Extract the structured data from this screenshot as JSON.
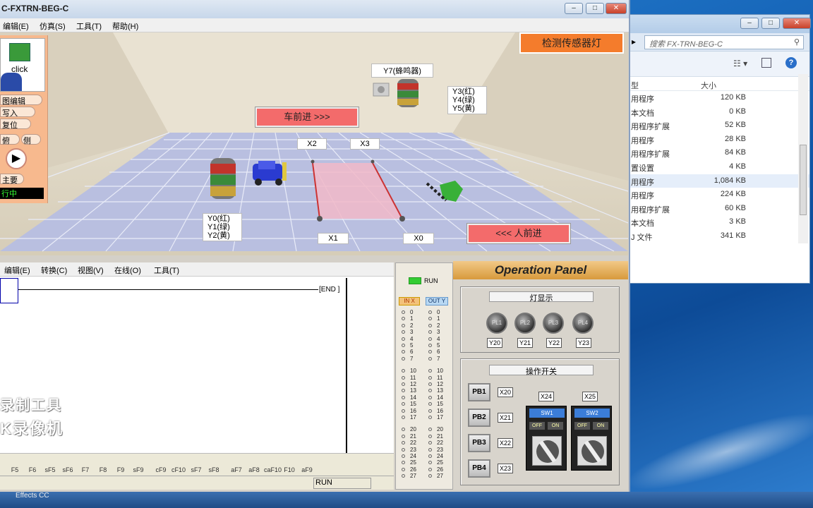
{
  "app": {
    "title": "C-FXTRN-BEG-C",
    "menu": [
      "编辑(E)",
      "仿真(S)",
      "工具(T)",
      "帮助(H)"
    ],
    "window_controls": [
      "minimize-icon",
      "maximize-icon",
      "close-icon"
    ]
  },
  "scene": {
    "sensor_button": "检测传感器灯",
    "car_forward": "车前进 >>>",
    "person_forward": "<<< 人前进",
    "buzzer_label": "Y7(蜂鸣器)",
    "tower_right_labels": [
      "Y3(红)",
      "Y4(绿)",
      "Y5(黄)"
    ],
    "tower_left_labels": [
      "Y0(红)",
      "Y1(绿)",
      "Y2(黄)"
    ],
    "sensors": {
      "x2": "X2",
      "x3": "X3",
      "x1": "X1",
      "x0": "X0"
    }
  },
  "left_strip": {
    "click": "click",
    "buttons": [
      "图编辑",
      "写入",
      "复位",
      "俯",
      "侧",
      "主要"
    ],
    "running": "行中"
  },
  "ladder": {
    "menu": [
      "编辑(E)",
      "转换(C)",
      "视图(V)",
      "在线(O)",
      "工具(T)"
    ],
    "end": "END",
    "watermark1": "录制工具",
    "watermark2": "K录像机",
    "fkeys": [
      "F5",
      "F6",
      "sF5",
      "sF6",
      "F7",
      "F8",
      "F9",
      "sF9",
      "cF9",
      "cF10",
      "sF7",
      "sF8",
      "aF7",
      "aF8",
      "caF10",
      "F10",
      "aF9"
    ],
    "status": "RUN"
  },
  "io": {
    "run": "RUN",
    "in_header": "IN X",
    "out_header": "OUT Y",
    "numbers": [
      "0",
      "1",
      "2",
      "3",
      "4",
      "5",
      "6",
      "7",
      "10",
      "11",
      "12",
      "13",
      "14",
      "15",
      "16",
      "17",
      "20",
      "21",
      "22",
      "23",
      "24",
      "25",
      "26",
      "27"
    ]
  },
  "panel": {
    "title": "Operation Panel",
    "lights_title": "灯显示",
    "lamps": [
      {
        "label": "PL1",
        "tag": "Y20"
      },
      {
        "label": "PL2",
        "tag": "Y21"
      },
      {
        "label": "PL3",
        "tag": "Y22"
      },
      {
        "label": "PL4",
        "tag": "Y23"
      }
    ],
    "switch_title": "操作开关",
    "pushbuttons": [
      {
        "label": "PB1",
        "tag": "X20"
      },
      {
        "label": "PB2",
        "tag": "X21"
      },
      {
        "label": "PB3",
        "tag": "X22"
      },
      {
        "label": "PB4",
        "tag": "X23"
      }
    ],
    "switches": [
      {
        "name": "SW1",
        "tag": "X24",
        "off": "OFF",
        "on": "ON"
      },
      {
        "name": "SW2",
        "tag": "X25",
        "off": "OFF",
        "on": "ON"
      }
    ]
  },
  "explorer": {
    "search_placeholder": "搜索 FX-TRN-BEG-C",
    "col_type": "型",
    "col_size": "大小",
    "rows": [
      {
        "type": "用程序",
        "size": "120 KB"
      },
      {
        "type": "本文档",
        "size": "0 KB"
      },
      {
        "type": "用程序扩展",
        "size": "52 KB"
      },
      {
        "type": "用程序",
        "size": "28 KB"
      },
      {
        "type": "用程序扩展",
        "size": "84 KB"
      },
      {
        "type": "置设置",
        "size": "4 KB"
      },
      {
        "type": "用程序",
        "size": "1,084 KB"
      },
      {
        "type": "用程序",
        "size": "224 KB"
      },
      {
        "type": "用程序扩展",
        "size": "60 KB"
      },
      {
        "type": "本文档",
        "size": "3 KB"
      },
      {
        "type": "J 文件",
        "size": "341 KB"
      }
    ],
    "selected_row": 6
  },
  "taskbar": {
    "text": "Effects CC"
  }
}
